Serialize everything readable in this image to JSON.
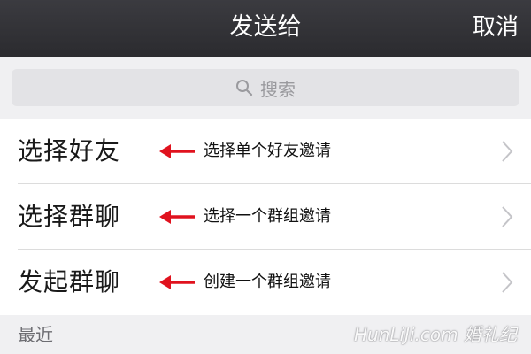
{
  "nav": {
    "title": "发送给",
    "cancel": "取消"
  },
  "search": {
    "placeholder": "搜索",
    "icon": "search-icon"
  },
  "rows": [
    {
      "label": "选择好友",
      "note": "选择单个好友邀请"
    },
    {
      "label": "选择群聊",
      "note": "选择一个群组邀请"
    },
    {
      "label": "发起群聊",
      "note": "创建一个群组邀请"
    }
  ],
  "section": {
    "recent": "最近"
  },
  "watermark": {
    "text": "HunLiJi.com 婚礼纪"
  },
  "colors": {
    "navbar": "#2f2f33",
    "annotation_arrow": "#e0121e",
    "background": "#f0f0f2",
    "search_box": "#e3e3e6"
  }
}
